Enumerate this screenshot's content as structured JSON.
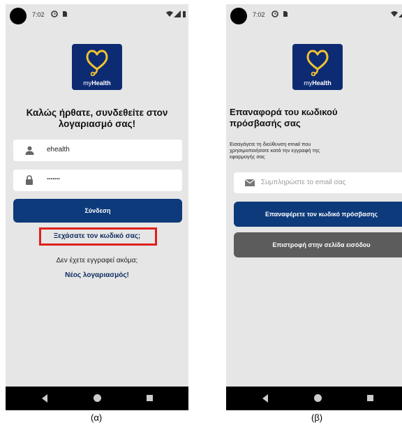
{
  "screen_a": {
    "status_time": "7:02",
    "brand": {
      "prefix": "my",
      "suffix": "Health"
    },
    "welcome_title_line1": "Καλώς ήρθατε, συνδεθείτε στον",
    "welcome_title_line2": "λογαριασμό σας!",
    "username_value": "ehealth",
    "password_value": "·······",
    "login_button": "Σύνδεση",
    "forgot_password_link": "Ξεχάσατε τον κωδικό σας;",
    "not_registered_text": "Δεν έχετε εγγραφεί ακόμα;",
    "new_account_link": "Νέος λογαριασμός!",
    "highlight_color": "#e0201c"
  },
  "screen_b": {
    "status_time": "7:02",
    "brand": {
      "prefix": "my",
      "suffix": "Health"
    },
    "title_line1": "Επαναφορά του κωδικού",
    "title_line2": "πρόσβασής σας",
    "instructions_line1": "Εισαγάγετε τη διεύθυνση email που",
    "instructions_line2": "χρησιμοποιήσατε κατά την εγγραφή της",
    "instructions_line3": "εφαρμογής σας",
    "email_placeholder": "Συμπληρώστε το email σας",
    "reset_button": "Επαναφέρετε τον κωδικό πρόσβασης",
    "back_button": "Επιστροφή στην σελίδα εισόδου"
  },
  "captions": {
    "a": "(α)",
    "b": "(β)"
  },
  "colors": {
    "primary": "#0d3a7a",
    "logo_bg": "#0d2b73",
    "heart": "#f1c232",
    "back_button": "#5c5c5c",
    "screen_bg": "#e6e6e6"
  },
  "icons": [
    "camera-punch-hole",
    "alarm-icon",
    "sim-icon",
    "wifi-icon",
    "signal-icon",
    "battery-icon",
    "heart-stethoscope-logo",
    "user-icon",
    "lock-icon",
    "envelope-icon",
    "nav-back-icon",
    "nav-home-icon",
    "nav-recents-icon"
  ]
}
